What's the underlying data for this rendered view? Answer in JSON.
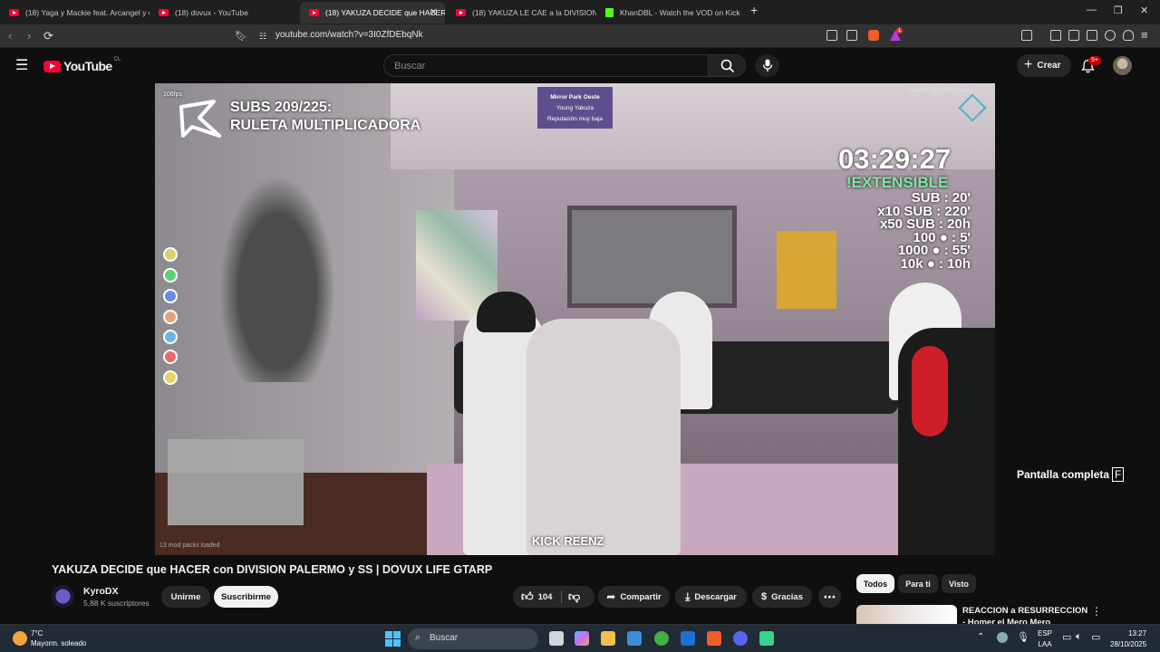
{
  "browser": {
    "tabs": [
      {
        "title": "(18) Yaga y Mackie feat. Arcangel y d",
        "favicon": "youtube-icon"
      },
      {
        "title": "(18) dovux - YouTube",
        "favicon": "youtube-icon"
      },
      {
        "title": "(18) YAKUZA DECIDE que HACER",
        "favicon": "youtube-icon",
        "active": true
      },
      {
        "title": "(18) YAKUZA LE CAE a la DIVISION P",
        "favicon": "youtube-icon"
      },
      {
        "title": "KhanDBL - Watch the VOD on Kick",
        "favicon": "kick-icon"
      }
    ],
    "url": "youtube.com/watch?v=3I0ZfDEbqNk",
    "extension_badge": "1"
  },
  "youtube": {
    "logo_text": "YouTube",
    "country_code": "CL",
    "search_placeholder": "Buscar",
    "create_label": "Crear",
    "notifications_badge": "9+"
  },
  "video_overlay": {
    "fps": "106fps",
    "subs_line1": "SUBS 209/225:",
    "subs_line2": "RULETA MULTIPLICADORA",
    "location_title": "Mirror Park Oeste",
    "location_line2": "Young Yakuza",
    "location_line3": "Reputación muy baja",
    "server_tag": "FiveM* (b3258) (Beta)",
    "timer": "03:29:27",
    "extensible": "!EXTENSIBLE",
    "rates": [
      "SUB : 20'",
      "x10 SUB : 220'",
      "x50 SUB : 20h",
      "100 ● : 5'",
      "1000 ● : 55'",
      "10k ● : 10h"
    ],
    "caption": "KICK REENZ",
    "mod_packs": "13 mod packs loaded",
    "fullscreen_tip": "Pantalla completa",
    "fullscreen_key": "F"
  },
  "video": {
    "title": "YAKUZA DECIDE que HACER con DIVISION PALERMO y SS | DOVUX LIFE GTARP",
    "channel_name": "KyroDX",
    "channel_subs": "5,88 K suscriptores",
    "join_label": "Unirme",
    "subscribe_label": "Suscribirme",
    "likes": "104",
    "share_label": "Compartir",
    "download_label": "Descargar",
    "thanks_label": "Gracias"
  },
  "sidebar": {
    "chips": [
      "Todos",
      "Para ti",
      "Visto"
    ],
    "suggestion_title": "REACCION a RESURRECCION - Homer el Mero Mero"
  },
  "taskbar": {
    "temperature": "7°C",
    "weather": "Mayorm. soleado",
    "search_label": "Buscar",
    "lang_line1": "ESP",
    "lang_line2": "LAA",
    "time": "13:27",
    "date": "28/10/2025"
  }
}
